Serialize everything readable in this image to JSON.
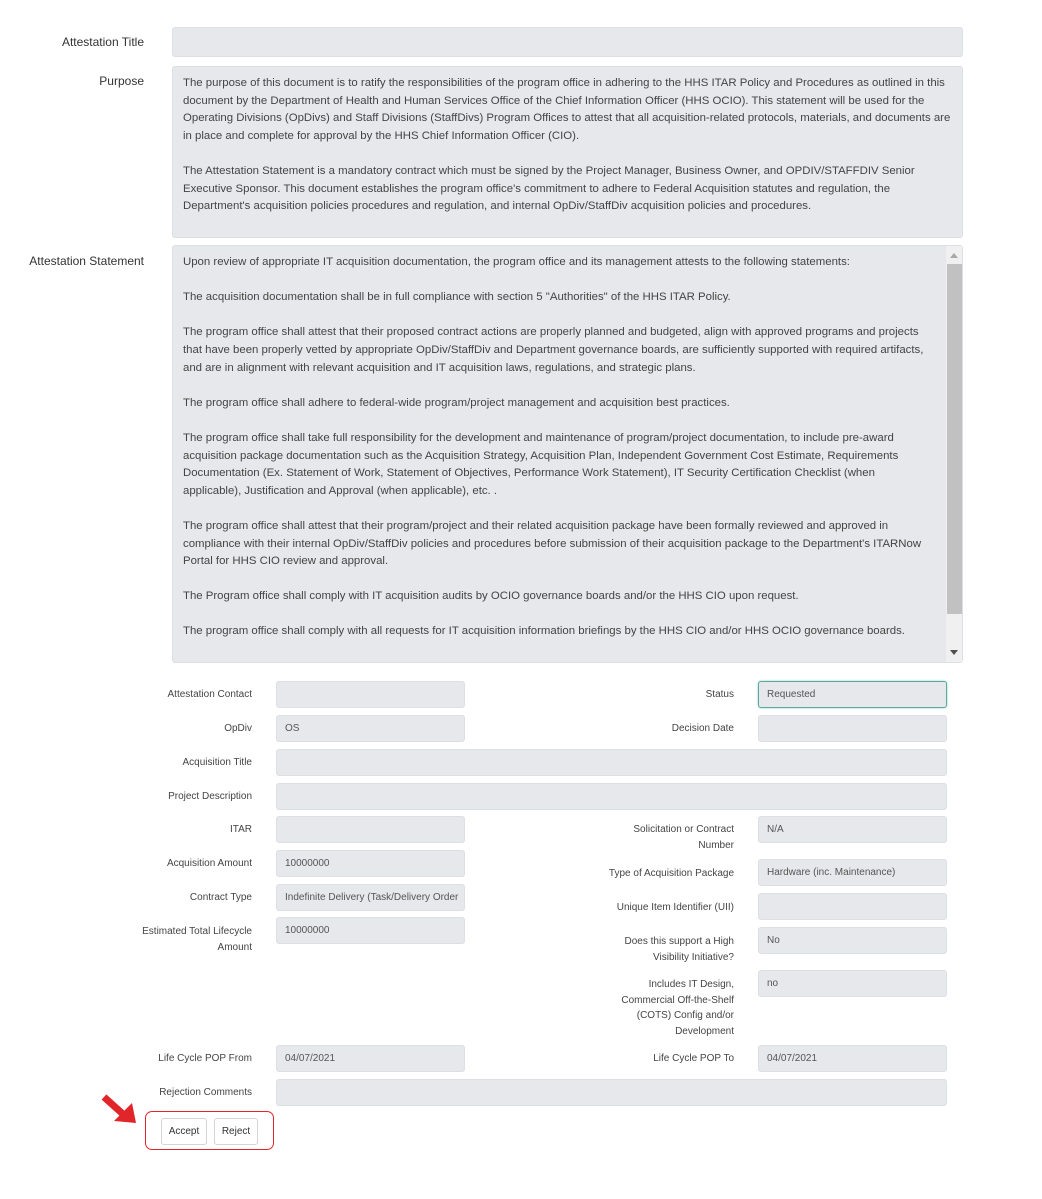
{
  "top": {
    "attestation_title": {
      "label": "Attestation Title",
      "value": ""
    },
    "purpose": {
      "label": "Purpose",
      "paragraphs": [
        "The purpose of this document is to ratify the responsibilities of the program office in adhering to the HHS ITAR Policy and Procedures as outlined in this document by the Department of Health and Human Services Office of the Chief Information Officer (HHS OCIO). This statement will be used for the Operating Divisions (OpDivs) and Staff Divisions (StaffDivs) Program Offices to attest that all acquisition-related protocols, materials, and documents are in place and complete for approval by the HHS Chief Information Officer (CIO).",
        "The Attestation Statement is a mandatory contract which must be signed by the Project Manager, Business Owner, and OPDIV/STAFFDIV Senior Executive Sponsor. This document establishes the program office's commitment to adhere to Federal Acquisition statutes and regulation, the Department's acquisition policies procedures and regulation, and internal OpDiv/StaffDiv acquisition policies and procedures."
      ]
    },
    "statement": {
      "label": "Attestation Statement",
      "paragraphs": [
        "Upon review of appropriate IT acquisition documentation, the program office and its management attests to the following statements:",
        "The acquisition documentation shall be in full compliance with section 5 \"Authorities\" of the HHS ITAR Policy.",
        "The program office shall attest that their proposed contract actions are properly planned and budgeted, align with approved programs and projects that have been properly vetted by appropriate OpDiv/StaffDiv and Department governance boards, are sufficiently supported with required artifacts, and are in alignment with relevant acquisition and IT acquisition laws, regulations, and strategic plans.",
        "The program office shall adhere to federal-wide program/project management and acquisition best practices.",
        "The program office shall take full responsibility for the development and maintenance of program/project documentation, to include pre-award acquisition package documentation such as the Acquisition Strategy, Acquisition Plan, Independent Government Cost Estimate, Requirements Documentation (Ex. Statement of Work, Statement of Objectives, Performance Work Statement), IT Security Certification Checklist (when applicable), Justification and Approval (when applicable), etc. .",
        "The program office shall attest that their program/project and their related acquisition package have been formally reviewed and approved in compliance with their internal OpDiv/StaffDiv policies and procedures before submission of their acquisition package to the Department's ITARNow Portal for HHS CIO review and approval.",
        "The Program office shall comply with IT acquisition audits by OCIO governance boards and/or the HHS CIO upon request.",
        "The program office shall comply with all requests for IT acquisition information briefings by the HHS CIO and/or HHS OCIO governance boards."
      ]
    }
  },
  "form": {
    "attestation_contact": {
      "label": "Attestation Contact",
      "value": ""
    },
    "status": {
      "label": "Status",
      "value": "Requested"
    },
    "opdiv": {
      "label": "OpDiv",
      "value": "OS"
    },
    "decision_date": {
      "label": "Decision Date",
      "value": ""
    },
    "acquisition_title": {
      "label": "Acquisition Title",
      "value": ""
    },
    "project_description": {
      "label": "Project Description",
      "value": ""
    },
    "itar": {
      "label": "ITAR",
      "value": ""
    },
    "solicitation": {
      "label": "Solicitation or Contract Number",
      "value": "N/A"
    },
    "acquisition_amount": {
      "label": "Acquisition Amount",
      "value": "10000000"
    },
    "acq_package_type": {
      "label": "Type of Acquisition Package",
      "value": "Hardware (inc. Maintenance)"
    },
    "contract_type": {
      "label": "Contract Type",
      "value": "Indefinite Delivery (Task/Delivery Order"
    },
    "uii": {
      "label": "Unique Item Identifier (UII)",
      "value": ""
    },
    "lifecycle_amount": {
      "label": "Estimated Total Lifecycle Amount",
      "value": "10000000"
    },
    "high_visibility": {
      "label": "Does this support a High Visibility Initiative?",
      "value": "No"
    },
    "it_design": {
      "label": "Includes IT Design, Commercial Off-the-Shelf (COTS) Config and/or Development",
      "value": "no"
    },
    "pop_from": {
      "label": "Life Cycle POP From",
      "value": "04/07/2021"
    },
    "pop_to": {
      "label": "Life Cycle POP To",
      "value": "04/07/2021"
    },
    "rejection_comments": {
      "label": "Rejection Comments",
      "value": ""
    }
  },
  "actions": {
    "accept": "Accept",
    "reject": "Reject"
  },
  "colors": {
    "annotation_red": "#e0262b",
    "focus_teal": "#5aa99c",
    "field_bg": "#e6e8eb"
  }
}
